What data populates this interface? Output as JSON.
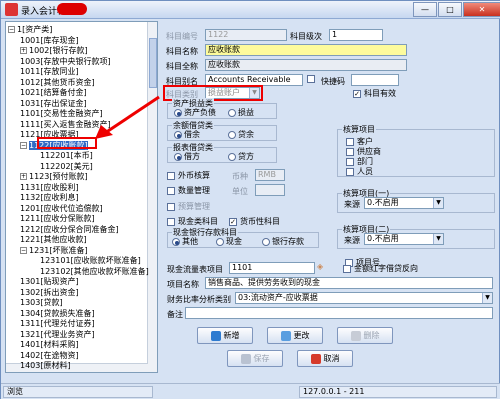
{
  "window": {
    "title": "录入会计科目",
    "minimize": "—",
    "maximize": "□",
    "close": "✕"
  },
  "tree": {
    "nodes": [
      {
        "text": "1[资产类]",
        "expander": "−"
      },
      {
        "text": "1001[库存现金]"
      },
      {
        "text": "1002[银行存款]",
        "expander": "+"
      },
      {
        "text": "1003[存放中央银行款项]"
      },
      {
        "text": "1011[存放同业]"
      },
      {
        "text": "1012[其他货币资金]"
      },
      {
        "text": "1021[结算备付金]"
      },
      {
        "text": "1031[存出保证金]"
      },
      {
        "text": "1101[交易性金融资产]"
      },
      {
        "text": "1111[买入返售金融资产]"
      },
      {
        "text": "1121[应收票据]"
      },
      {
        "text": "1122[应收账款]",
        "expander": "−"
      },
      {
        "text": "112201[本币]"
      },
      {
        "text": "112202[美元]"
      },
      {
        "text": "1123[预付账款]",
        "expander": "+"
      },
      {
        "text": "1131[应收股利]"
      },
      {
        "text": "1132[应收利息]"
      },
      {
        "text": "1201[应收代位追偿款]"
      },
      {
        "text": "1211[应收分保账款]"
      },
      {
        "text": "1212[应收分保合同准备金]"
      },
      {
        "text": "1221[其他应收款]"
      },
      {
        "text": "1231[坏账准备]",
        "expander": "−"
      },
      {
        "text": "123101[应收账款坏账准备]"
      },
      {
        "text": "123102[其他应收款坏账准备]"
      },
      {
        "text": "1301[贴现资产]"
      },
      {
        "text": "1302[拆出资金]"
      },
      {
        "text": "1303[贷款]"
      },
      {
        "text": "1304[贷款损失准备]"
      },
      {
        "text": "1311[代理兑付证券]"
      },
      {
        "text": "1321[代理业务资产]"
      },
      {
        "text": "1401[材料采购]"
      },
      {
        "text": "1402[在途物资]"
      },
      {
        "text": "1403[原材料]"
      }
    ]
  },
  "form": {
    "code_label": "科目编号",
    "code_value": "1122",
    "level_label": "科目级次",
    "level_value": "1",
    "name_label": "科目名称",
    "name_value": "应收账款",
    "fullname_label": "科目全称",
    "fullname_value": "应收账款",
    "alias_label": "科目别名",
    "alias_value": "Accounts Receivable",
    "shortcode_label": "快捷码",
    "shortcode_value": "",
    "category_label": "科目类别",
    "category_value": "损益账户",
    "valid_label": "科目有效",
    "valid_mark": "✓",
    "attr_group": "资产损益类",
    "asset_debt": "资产负债",
    "profit_loss": "损益",
    "balance_group": "余额借贷类",
    "debit": "借余",
    "credit": "贷余",
    "report_group": "报表借贷类",
    "report_debit": "借方",
    "report_credit": "贷方",
    "foreign_label": "外币核算",
    "currency_label": "币种",
    "currency_value": "RMB",
    "qty_label": "数量管理",
    "unit_label": "单位",
    "unit_value": "",
    "budget_label": "预算管理",
    "cash_label": "现金类科目",
    "monetary_label": "货币性科目",
    "monetary_mark": "✓",
    "cashbank_group": "现金银行存款科目",
    "other": "其他",
    "cash": "现金",
    "bank": "银行存款",
    "aux_group": "核算项目",
    "customer": "客户",
    "supplier": "供应商",
    "dept": "部门",
    "person": "人员",
    "aux1_group": "核算项目(一)",
    "source_label": "来源",
    "aux1_value": "0.不启用",
    "aux2_group": "核算项目(二)",
    "source2_label": "来源",
    "aux2_value": "0.不启用",
    "project_label": "项目号",
    "cashflow_label": "现金流量表项目",
    "cashflow_value": "1101",
    "redflag_label": "金额红字借贷反向",
    "item_label": "项目名称",
    "item_value": "销售商品、提供劳务收到的现金",
    "ratio_label": "财务比率分析类别",
    "ratio_value": "03:流动资产-应收票据",
    "remark_label": "备注",
    "remark_value": ""
  },
  "buttons": {
    "new": "新增",
    "edit": "更改",
    "delete": "删除",
    "save": "保存",
    "cancel": "取消"
  },
  "status": {
    "left": "浏览",
    "server": "127.0.0.1 - 211"
  },
  "colors": {
    "highlight": "#ff0000",
    "selection": "#316ac5",
    "yellow_field": "#fdfb9c"
  }
}
